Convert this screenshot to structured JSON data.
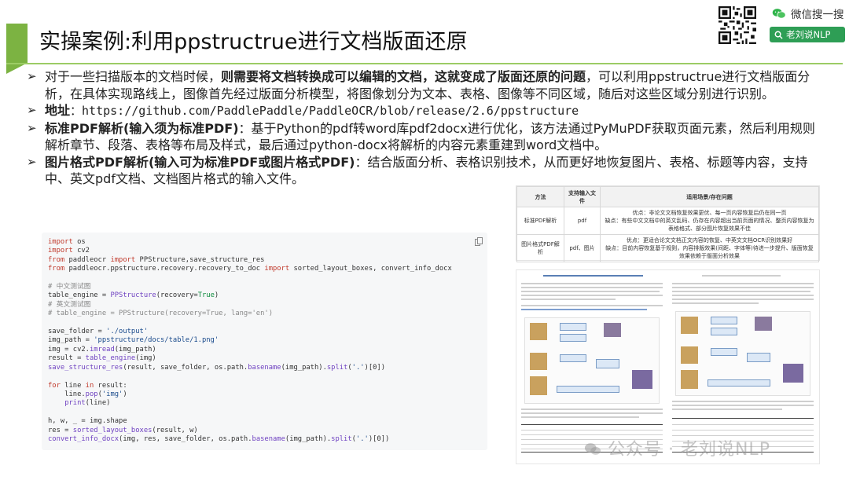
{
  "title": "实操案例:利用ppstructrue进行文档版面还原",
  "header": {
    "wechat_search_label": "微信搜一搜",
    "account_button_label": "老刘说NLP"
  },
  "bullets": [
    {
      "plain_start": "对于一些扫描版本的文档时候，",
      "bold": "则需要将文档转换成可以编辑的文档，这就变成了版面还原的问题",
      "rest": "，可以利用ppstructrue进行文档版面分析，在具体实现路线上，图像首先经过版面分析模型，将图像划分为文本、表格、图像等不同区域，随后对这些区域分别进行识别。"
    },
    {
      "bold": "地址",
      "rest": "：https://github.com/PaddlePaddle/PaddleOCR/blob/release/2.6/ppstructure"
    },
    {
      "bold": "标准PDF解析(输入须为标准PDF)",
      "rest": "：基于Python的pdf转word库pdf2docx进行优化，该方法通过PyMuPDF获取页面元素，然后利用规则解析章节、段落、表格等布局及样式，最后通过python-docx将解析的内容元素重建到word文档中。"
    },
    {
      "bold": "图片格式PDF解析(输入可为标准PDF或图片格式PDF)",
      "rest": "：结合版面分析、表格识别技术，从而更好地恢复图片、表格、标题等内容，支持中、英文pdf文档、文档图片格式的输入文件。"
    }
  ],
  "code_lines": [
    "import os",
    "import cv2",
    "from paddleocr import PPStructure,save_structure_res",
    "from paddleocr.ppstructure.recovery.recovery_to_doc import sorted_layout_boxes, convert_info_docx",
    "",
    "# 中文测试图",
    "table_engine = PPStructure(recovery=True)",
    "# 英文测试图",
    "# table_engine = PPStructure(recovery=True, lang='en')",
    "",
    "save_folder = './output'",
    "img_path = 'ppstructure/docs/table/1.png'",
    "img = cv2.imread(img_path)",
    "result = table_engine(img)",
    "save_structure_res(result, save_folder, os.path.basename(img_path).split('.')[0])",
    "",
    "for line in result:",
    "    line.pop('img')",
    "    print(line)",
    "",
    "h, w, _ = img.shape",
    "res = sorted_layout_boxes(result, w)",
    "convert_info_docx(img, res, save_folder, os.path.basename(img_path).split('.')[0])"
  ],
  "method_table": {
    "headers": [
      "方法",
      "支持输入文件",
      "适用场景/存在问题"
    ],
    "rows": [
      {
        "method": "标准PDF解析",
        "input": "pdf",
        "pro": "优点：非论文文档恢复效果更优、每一页内容恢复后仍在同一页",
        "con": "缺点：有些中文文档中的英文乱码、仍存在内容超出当前页面的情况、整页内容恢复为表格格式、部分图片恢复效果不佳"
      },
      {
        "method": "图片格式PDF解析",
        "input": "pdf、图片",
        "pro": "优点：更适合论文文档正文内容的恢复、中英文文档OCR识别效果好",
        "con": "缺点：目前内容恢复基于规则，内容排版效果(间距、字体等)待进一步提升、版面恢复效果依赖于版面分析效果"
      }
    ]
  },
  "watermark": "公众号 · 老刘说NLP",
  "colors": {
    "accent_green": "#7cb342",
    "button_green": "#2e9e55"
  }
}
